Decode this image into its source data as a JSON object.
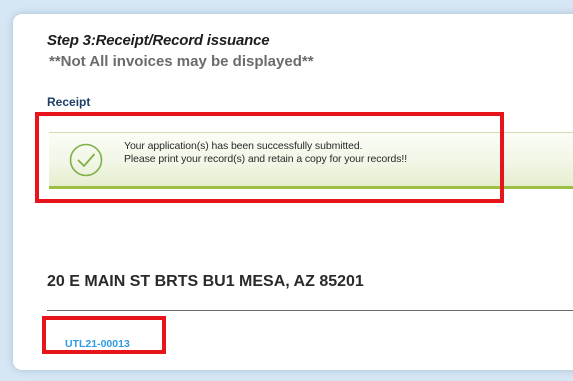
{
  "step": {
    "title": "Step 3:Receipt/Record issuance",
    "note": "**Not All invoices may be displayed**"
  },
  "receipt": {
    "label": "Receipt"
  },
  "success": {
    "icon": "check-circle-icon",
    "line1": "Your application(s) has been successfully submitted.",
    "line2": "Please print your record(s) and retain a copy for your records!!"
  },
  "address": {
    "text": "20 E MAIN ST BRTS BU1 MESA, AZ 85201"
  },
  "record": {
    "id": "UTL21-00013"
  },
  "colors": {
    "highlight": "#e8141c",
    "success_green": "#7fb04a",
    "link_blue": "#2e9be3",
    "label_navy": "#1f3f66"
  }
}
